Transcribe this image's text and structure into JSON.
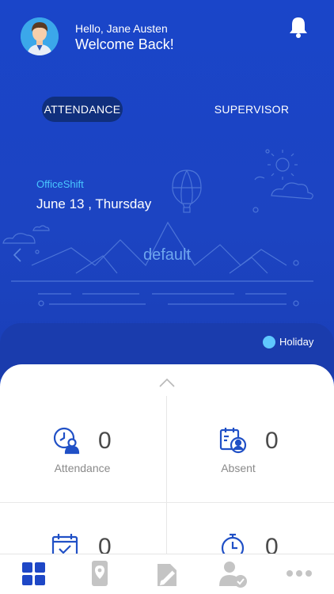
{
  "header": {
    "greeting": "Hello,  Jane Austen",
    "welcome": "Welcome Back!"
  },
  "tabs": [
    {
      "label": "ATTENDANCE",
      "active": true
    },
    {
      "label": "SUPERVISOR",
      "active": false
    }
  ],
  "shift": {
    "name": "OfficeShift",
    "date": "June 13 ,  Thursday",
    "schedule": "default"
  },
  "legend": {
    "holiday_label": "Holiday",
    "holiday_color": "#5fc8ff"
  },
  "stats": [
    {
      "label": "Attendance",
      "value": "0",
      "icon": "attendance-clock-icon"
    },
    {
      "label": "Absent",
      "value": "0",
      "icon": "absent-calendar-icon"
    },
    {
      "label": "",
      "value": "0",
      "icon": "calendar-check-icon"
    },
    {
      "label": "",
      "value": "0",
      "icon": "stopwatch-icon"
    }
  ],
  "bottom_nav": [
    {
      "icon": "dashboard-grid-icon",
      "active": true
    },
    {
      "icon": "location-phone-icon",
      "active": false
    },
    {
      "icon": "edit-document-icon",
      "active": false
    },
    {
      "icon": "user-check-icon",
      "active": false
    },
    {
      "icon": "more-dots-icon",
      "active": false
    }
  ],
  "colors": {
    "primary": "#1c47c4",
    "accent": "#49c6ff",
    "active_nav": "#1e47c6",
    "inactive_nav": "#c4c4c4"
  }
}
